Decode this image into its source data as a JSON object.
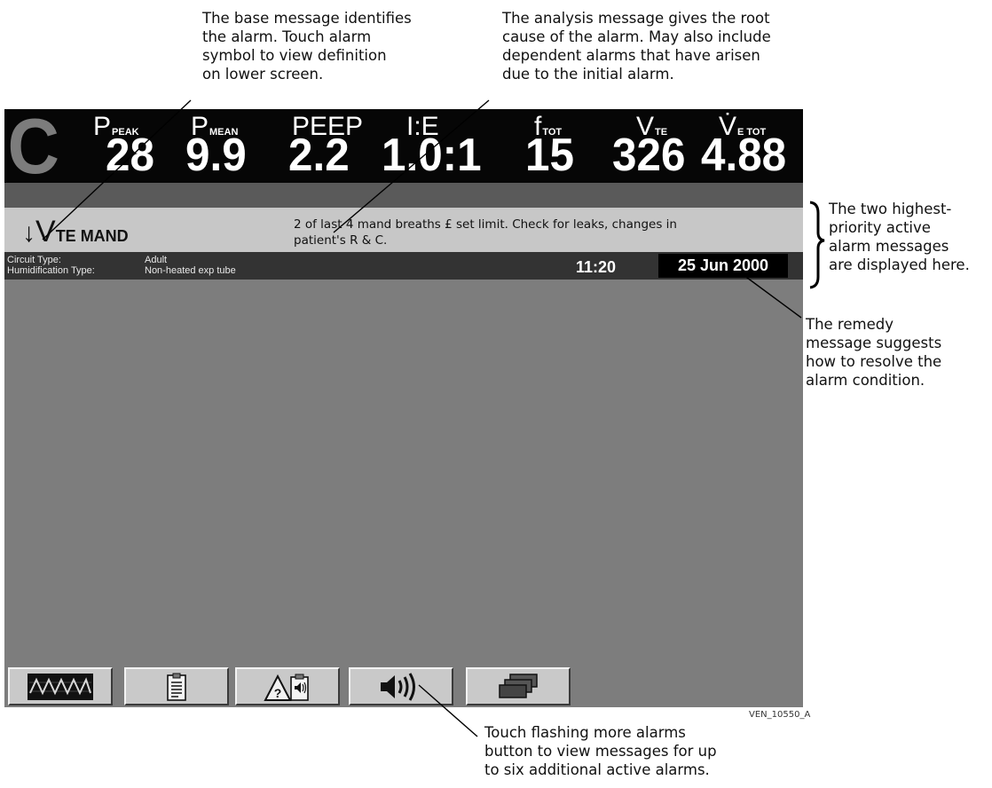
{
  "callouts": {
    "base": [
      "The base message identifies",
      "the alarm. Touch alarm",
      "symbol to view definition",
      "on lower screen."
    ],
    "analysis": [
      "The analysis message gives the root",
      "cause of the alarm. May also include",
      "dependent alarms that have arisen",
      "due to the initial alarm."
    ],
    "priority": [
      "The two highest-",
      "priority active",
      "alarm messages",
      "are displayed here."
    ],
    "remedy": [
      "The remedy",
      "message suggests",
      "how to resolve the",
      "alarm condition."
    ],
    "more_alarms": [
      "Touch flashing more alarms",
      "button to view messages for up",
      "to six additional active alarms."
    ]
  },
  "mode": "C",
  "parameters": [
    {
      "name": "P",
      "sub": "PEAK",
      "value": "28"
    },
    {
      "name": "P",
      "sub": "MEAN",
      "value": "9.9"
    },
    {
      "name": "PEEP",
      "sub": "",
      "value": "2.2"
    },
    {
      "name": "I:E",
      "sub": "",
      "value": "1.0:1"
    },
    {
      "name": "f",
      "sub": "TOT",
      "value": "15"
    },
    {
      "name": "V",
      "sub": "TE",
      "value": "326"
    },
    {
      "name": "V̇",
      "sub": "E TOT",
      "value": "4.88"
    }
  ],
  "alarm": {
    "arrow": "↓",
    "base_symbol": "V",
    "base_sub": "TE MAND",
    "analysis_line1": "2 of last 4 mand breaths £ set limit. Check for leaks, changes in",
    "analysis_line2": "patient's R & C."
  },
  "info": {
    "circuit_label": "Circuit Type:",
    "circuit_value": "Adult",
    "humid_label": "Humidification Type:",
    "humid_value": "Non-heated exp tube",
    "time": "11:20",
    "date": "25 Jun 2000"
  },
  "buttons": [
    {
      "name": "waveforms-button",
      "icon": "waveform-icon"
    },
    {
      "name": "patient-data-button",
      "icon": "clipboard-icon"
    },
    {
      "name": "alarm-log-button",
      "icon": "alarm-log-icon"
    },
    {
      "name": "more-alarms-button",
      "icon": "speaker-icon"
    },
    {
      "name": "other-screens-button",
      "icon": "stacked-screens-icon"
    }
  ],
  "figure_code": "VEN_10550_A"
}
